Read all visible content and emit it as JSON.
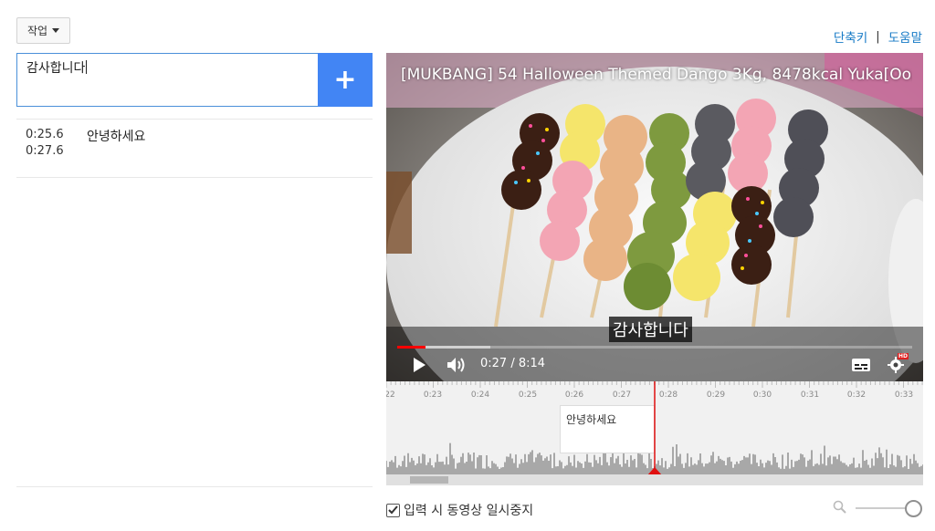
{
  "toolbar": {
    "actions_label": "작업"
  },
  "header_links": {
    "shortcuts": "단축키",
    "separator": "|",
    "help": "도움말"
  },
  "editor": {
    "input_value": "감사합니다",
    "add_label": "+"
  },
  "captions": [
    {
      "start": "0:25.6",
      "end": "0:27.6",
      "text": "안녕하세요"
    }
  ],
  "video": {
    "title": "[MUKBANG] 54 Halloween Themed Dango 3Kg, 8478kcal Yuka[Oo...",
    "subtitle": "감사합니다",
    "current_time": "0:27",
    "duration": "8:14",
    "time_display": "0:27 / 8:14",
    "progress_fraction": 0.055,
    "buffered_fraction": 0.18
  },
  "timeline": {
    "tick_labels": [
      "0:23",
      "0:24",
      "0:25",
      "0:26",
      "0:27",
      "0:28",
      "0:29",
      "0:30",
      "0:31",
      "0:32",
      "0:33"
    ],
    "left_edge_label": "22",
    "cue_text": "안녕하세요"
  },
  "options": {
    "pause_while_typing": "입력 시 동영상 일시중지",
    "pause_checked": true
  },
  "colors": {
    "accent": "#4285f4",
    "link": "#167ac6",
    "playhead": "#e01010",
    "waveform": "#a8a8a8"
  }
}
